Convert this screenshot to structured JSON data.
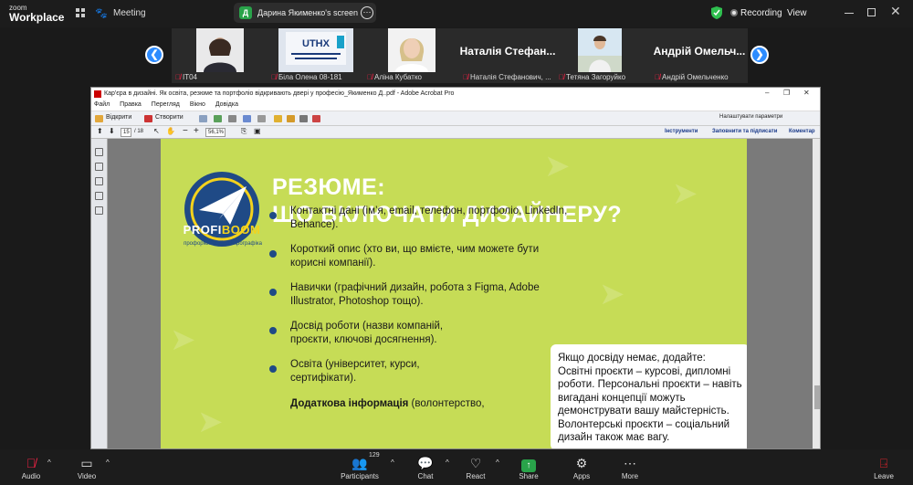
{
  "topbar": {
    "brand_line1": "zoom",
    "brand_line2": "Workplace",
    "meeting_label": "Meeting",
    "share_badge": "Д",
    "share_text": "Дарина Якименко's screen",
    "recording_label": "Recording",
    "view_label": "View"
  },
  "strip": {
    "tiles": [
      {
        "foot": "IT04",
        "kind": "video"
      },
      {
        "foot": "Біла Олена 08-181",
        "kind": "logo"
      },
      {
        "foot": "Аліна Кубатко",
        "kind": "video"
      },
      {
        "foot": "Наталія Стефанович, ...",
        "kind": "name",
        "big": "Наталія Стефан..."
      },
      {
        "foot": "Тетяна Загоруйко",
        "kind": "video"
      },
      {
        "foot": "Андрій Омельченко",
        "kind": "name",
        "big": "Андрій  Омельч..."
      }
    ],
    "logo_tile_text": "UTHX"
  },
  "acrobat": {
    "title": "Кар'єра в дизайні. Як освіта, резюме та портфоліо відкривають двері у професію_Якименко Д..pdf - Adobe Acrobat Pro",
    "menu": [
      "Файл",
      "Правка",
      "Перегляд",
      "Вікно",
      "Довідка"
    ],
    "open_label": "Відкрити",
    "create_label": "Створити",
    "settings_label": "Налаштувати параметри",
    "page_current": "15",
    "page_total": "/ 18",
    "zoom": "56,1%",
    "tools_link": "Інструменти",
    "sign_link": "Заповнити та підписати",
    "comment_link": "Коментар"
  },
  "slide": {
    "logo_profi": "PROFI",
    "logo_boom": "BOOM",
    "logo_sub": "профорієнтаційна інфографіка",
    "title_line1": "РЕЗЮМЕ:",
    "title_line2": "ЩО ВКЛЮЧАТИ ДИЗАЙНЕРУ?",
    "bullets": [
      "Контактні дані (ім’я, email, телефон, портфоліо, LinkedIn, Behance).",
      "Короткий опис (хто ви, що вмієте, чим можете бути корисні компанії).",
      "Навички (графічний дизайн, робота з Figma, Adobe Illustrator, Photoshop тощо).",
      "Досвід роботи (назви компаній, проєкти, ключові досягнення).",
      "Освіта (університет, курси, сертифікати)."
    ],
    "extra_bold": "Додаткова інформація",
    "extra_rest": " (волонтерство,",
    "note": "Якщо досвіду немає, додайте: Освітні проєкти – курсові, дипломні роботи. Персональні проєкти – навіть вигадані концепції можуть демонструвати вашу майстерність. Волонтерські проєкти – соціальний дизайн також має вагу."
  },
  "toolbar": {
    "audio": "Audio",
    "video": "Video",
    "participants": "Participants",
    "participants_count": "129",
    "chat": "Chat",
    "react": "React",
    "share": "Share",
    "apps": "Apps",
    "more": "More",
    "leave": "Leave"
  },
  "colors": {
    "slide_bg": "#c6dc56",
    "slide_blue": "#1f4a86",
    "zoom_blue": "#2d8cff",
    "share_green": "#29a34a",
    "leave_red": "#e0242c"
  }
}
